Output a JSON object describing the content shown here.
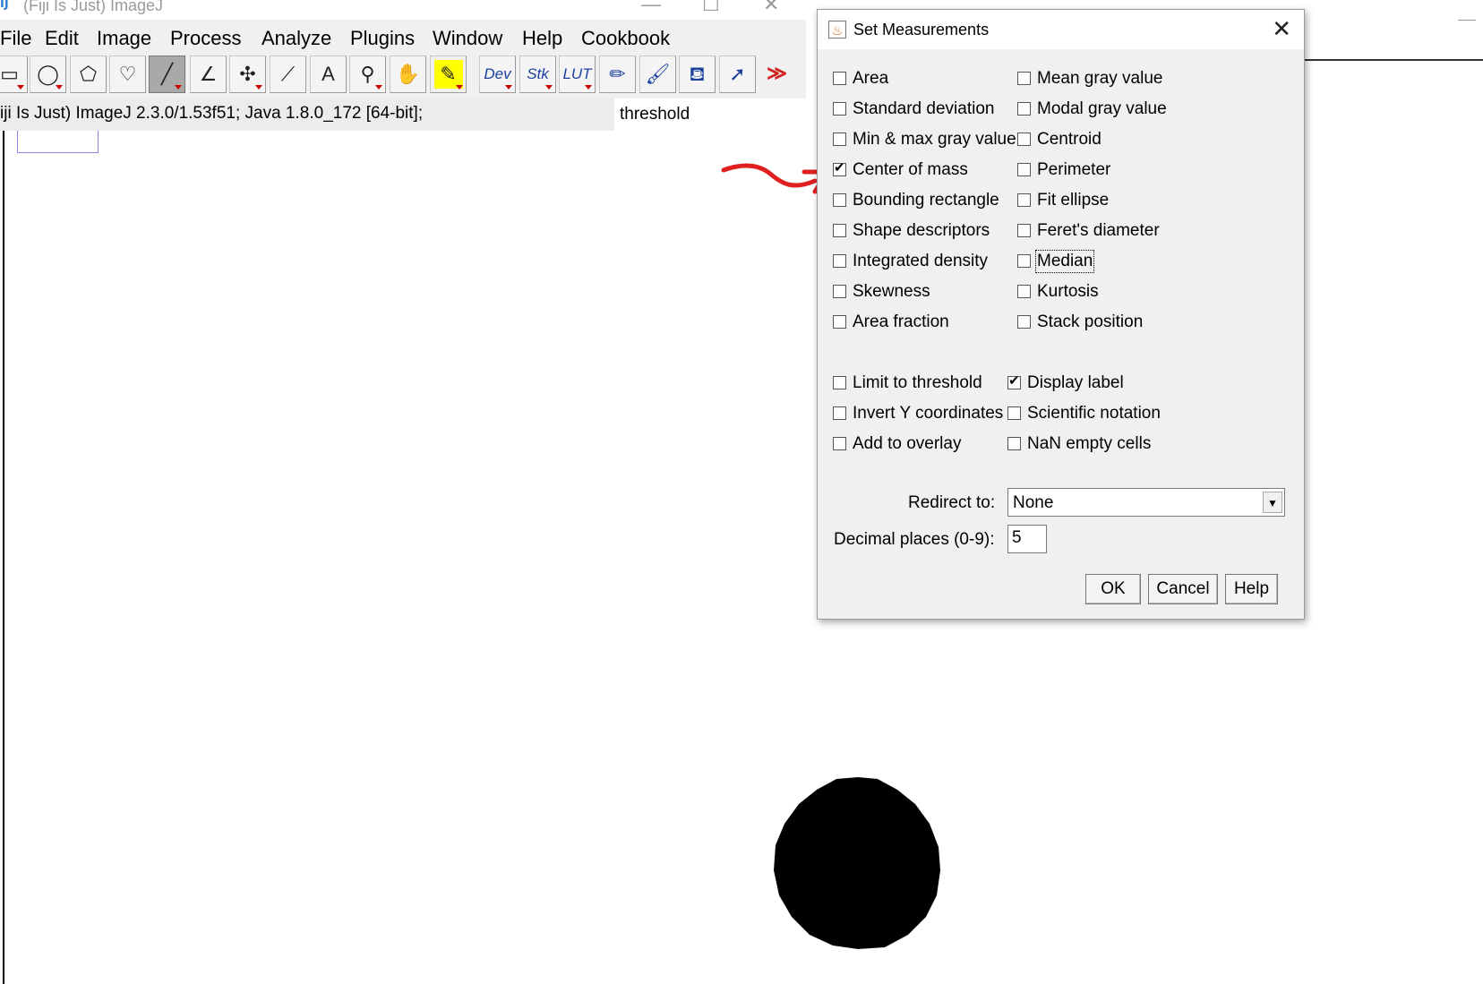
{
  "main_window": {
    "icon": "IJ",
    "title": "(Fiji Is Just) ImageJ",
    "controls": {
      "minimize": "—",
      "maximize": "☐",
      "close": "✕"
    },
    "menu": [
      "File",
      "Edit",
      "Image",
      "Process",
      "Analyze",
      "Plugins",
      "Window",
      "Help",
      "Cookbook"
    ],
    "tools": [
      {
        "name": "rectangle-tool",
        "glyph": "▭"
      },
      {
        "name": "oval-tool",
        "glyph": "◯"
      },
      {
        "name": "polygon-tool",
        "glyph": "⬠"
      },
      {
        "name": "freehand-tool",
        "glyph": "♡"
      },
      {
        "name": "line-tool",
        "glyph": "╱"
      },
      {
        "name": "angle-tool",
        "glyph": "∠"
      },
      {
        "name": "multipoint-tool",
        "glyph": "✣"
      },
      {
        "name": "wand-tool",
        "glyph": "⟋"
      },
      {
        "name": "text-tool",
        "glyph": "A"
      },
      {
        "name": "magnifier-tool",
        "glyph": "⚲"
      },
      {
        "name": "hand-tool",
        "glyph": "✋"
      },
      {
        "name": "color-picker-tool",
        "glyph": "✎"
      },
      {
        "name": "dev-menu-tool",
        "glyph": "Dev"
      },
      {
        "name": "stk-menu-tool",
        "glyph": "Stk"
      },
      {
        "name": "lut-menu-tool",
        "glyph": "LUT"
      },
      {
        "name": "pencil-tool",
        "glyph": "✏"
      },
      {
        "name": "brush-tool",
        "glyph": "🖌"
      },
      {
        "name": "flood-fill-tool",
        "glyph": "⛾"
      },
      {
        "name": "arrow-tool",
        "glyph": "➚"
      },
      {
        "name": "more-tools",
        "glyph": "≫"
      }
    ],
    "status": "iji Is Just) ImageJ 2.3.0/1.53f51; Java 1.8.0_172 [64-bit];",
    "search": "threshold"
  },
  "dialog": {
    "title": "Set Measurements",
    "close_glyph": "✕",
    "measurements_left": [
      {
        "label": "Area",
        "checked": false
      },
      {
        "label": "Standard deviation",
        "checked": false
      },
      {
        "label": "Min & max gray value",
        "checked": false
      },
      {
        "label": "Center of mass",
        "checked": true
      },
      {
        "label": "Bounding rectangle",
        "checked": false
      },
      {
        "label": "Shape descriptors",
        "checked": false
      },
      {
        "label": "Integrated density",
        "checked": false
      },
      {
        "label": "Skewness",
        "checked": false
      },
      {
        "label": "Area fraction",
        "checked": false
      }
    ],
    "measurements_right": [
      {
        "label": "Mean gray value",
        "checked": false
      },
      {
        "label": "Modal gray value",
        "checked": false
      },
      {
        "label": "Centroid",
        "checked": false
      },
      {
        "label": "Perimeter",
        "checked": false
      },
      {
        "label": "Fit ellipse",
        "checked": false
      },
      {
        "label": "Feret's diameter",
        "checked": false
      },
      {
        "label": "Median",
        "checked": false
      },
      {
        "label": "Kurtosis",
        "checked": false
      },
      {
        "label": "Stack position",
        "checked": false
      }
    ],
    "options_left": [
      {
        "label": "Limit to threshold",
        "checked": false
      },
      {
        "label": "Invert Y coordinates",
        "checked": false
      },
      {
        "label": "Add to overlay",
        "checked": false
      }
    ],
    "options_right": [
      {
        "label": "Display label",
        "checked": true
      },
      {
        "label": "Scientific notation",
        "checked": false
      },
      {
        "label": "NaN empty cells",
        "checked": false
      }
    ],
    "redirect_label": "Redirect to:",
    "redirect_value": "None",
    "decimal_label": "Decimal places (0-9):",
    "decimal_value": "5",
    "buttons": {
      "ok": "OK",
      "cancel": "Cancel",
      "help": "Help"
    }
  },
  "colors": {
    "annotation_arrow": "#e02020",
    "dialog_bg": "#f0f0f0",
    "title_gray": "#9a9a9a"
  }
}
